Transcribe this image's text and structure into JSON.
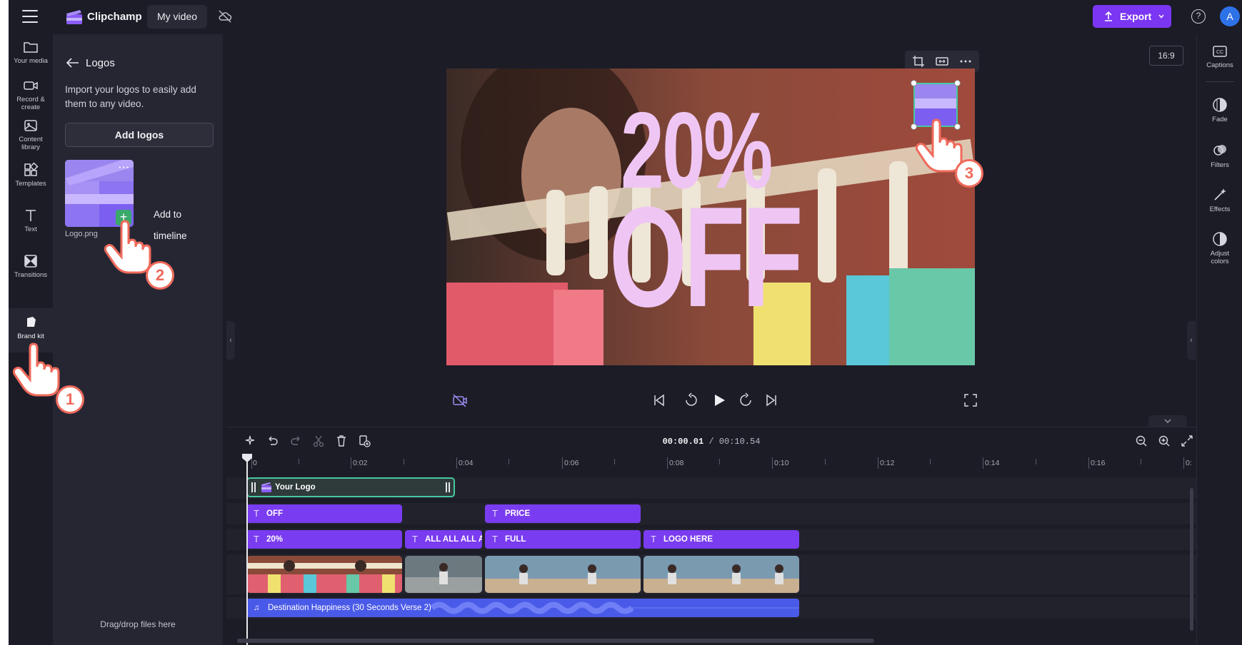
{
  "app": {
    "name": "Clipchamp",
    "video_title": "My video"
  },
  "header": {
    "export_label": "Export",
    "help_symbol": "?",
    "avatar_initial": "A"
  },
  "left_rail": [
    {
      "label": "Your media",
      "icon": "folder-icon"
    },
    {
      "label": "Record & create",
      "icon": "camera-icon"
    },
    {
      "label": "Content library",
      "icon": "library-icon"
    },
    {
      "label": "Templates",
      "icon": "templates-icon"
    },
    {
      "label": "Text",
      "icon": "text-icon"
    },
    {
      "label": "Transitions",
      "icon": "transitions-icon"
    },
    {
      "label": "Brand kit",
      "icon": "brand-kit-icon"
    }
  ],
  "panel": {
    "title": "Logos",
    "description": "Import your logos to easily add them to any video.",
    "add_button": "Add logos",
    "logo_filename": "Logo.png",
    "add_to_timeline_tip": "Add to timeline",
    "dragdrop_text": "Drag/drop files here"
  },
  "preview": {
    "aspect_ratio": "16:9",
    "overlay_line1": "20%",
    "overlay_line2": "OFF"
  },
  "right_rail": [
    {
      "label": "Captions",
      "icon": "captions-icon"
    },
    {
      "label": "Fade",
      "icon": "fade-icon"
    },
    {
      "label": "Filters",
      "icon": "filters-icon"
    },
    {
      "label": "Effects",
      "icon": "effects-icon"
    },
    {
      "label": "Adjust colors",
      "icon": "adjust-colors-icon"
    }
  ],
  "timeline": {
    "current_time": "00:00.01",
    "total_time": "/ 00:10.54",
    "ruler_labels": [
      "0",
      "0:02",
      "0:04",
      "0:06",
      "0:08",
      "0:10",
      "0:12",
      "0:14",
      "0:16",
      "0:"
    ],
    "logo_track": "Your Logo",
    "text_track_1": [
      "OFF",
      "PRICE"
    ],
    "text_track_2": [
      "20%",
      "ALL ALL ALL A",
      "FULL",
      "LOGO HERE"
    ],
    "audio_track": "Destination Happiness (30 Seconds Verse 2)"
  },
  "tutorial_steps": [
    "1",
    "2",
    "3"
  ],
  "colors": {
    "accent": "#7a36f2",
    "text_clip": "#7a3cf0",
    "audio_clip": "#4a5ae8",
    "selection": "#46c8a0",
    "step": "#ef6a5b"
  }
}
